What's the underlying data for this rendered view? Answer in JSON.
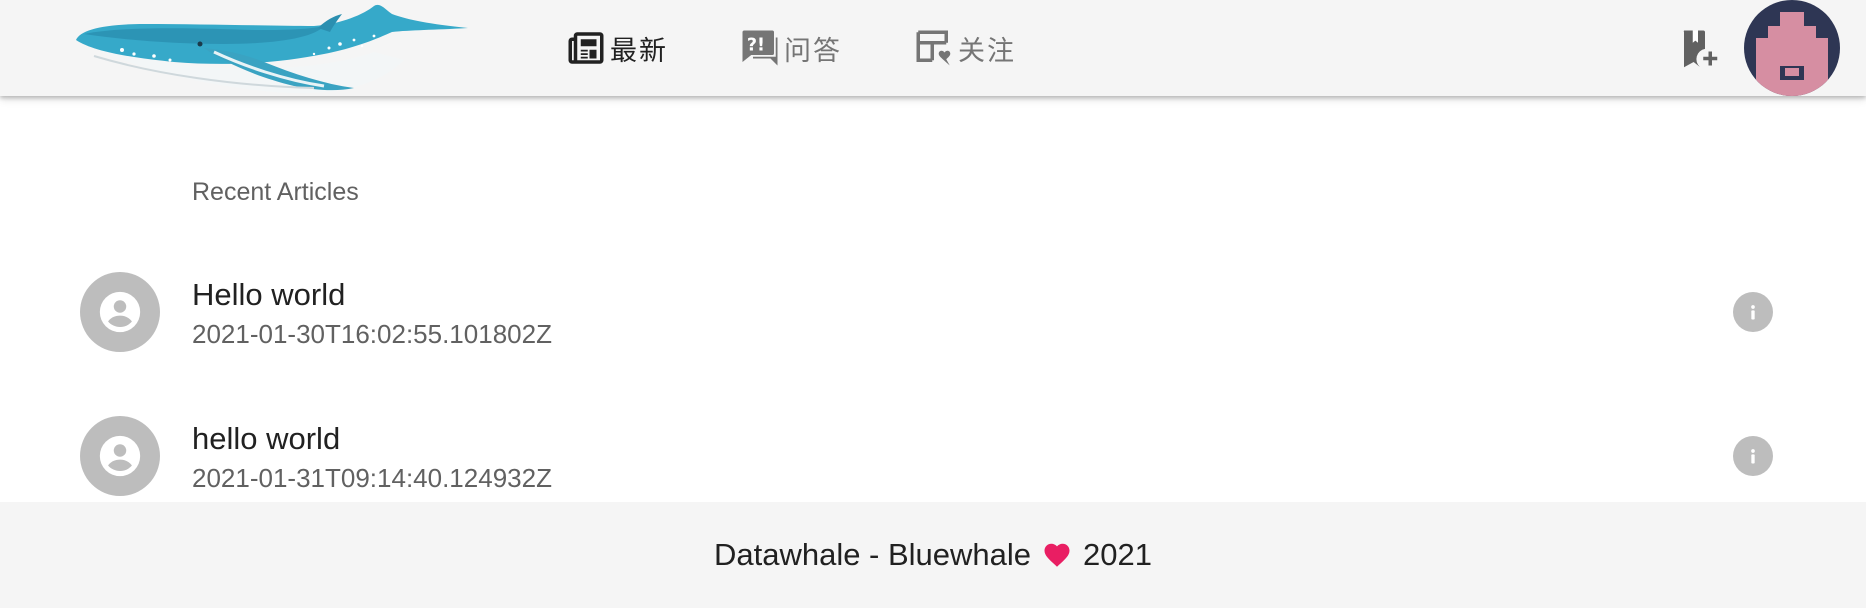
{
  "header": {
    "logo_icon": "whale-logo",
    "nav": [
      {
        "label": "最新",
        "icon": "newspaper-icon",
        "active": true
      },
      {
        "label": "问答",
        "icon": "question-answer-icon",
        "active": false
      },
      {
        "label": "关注",
        "icon": "follow-dashboard-icon",
        "active": false
      }
    ],
    "new_article_icon": "bookmark-plus-icon",
    "avatar_icon": "user-avatar"
  },
  "main": {
    "section_title": "Recent Articles",
    "articles": [
      {
        "title": "Hello world",
        "time": "2021-01-30T16:02:55.101802Z"
      },
      {
        "title": "hello world",
        "time": "2021-01-31T09:14:40.124932Z"
      }
    ]
  },
  "footer": {
    "left_text": "Datawhale - Bluewhale",
    "right_text": "2021",
    "heart_color": "#e91e63"
  },
  "colors": {
    "header_bg": "#f5f5f5",
    "whale_blue": "#36a9c9",
    "avatar_bg": "#2e3654",
    "avatar_pink": "#d68ea2",
    "icon_gray": "#bdbdbd"
  }
}
